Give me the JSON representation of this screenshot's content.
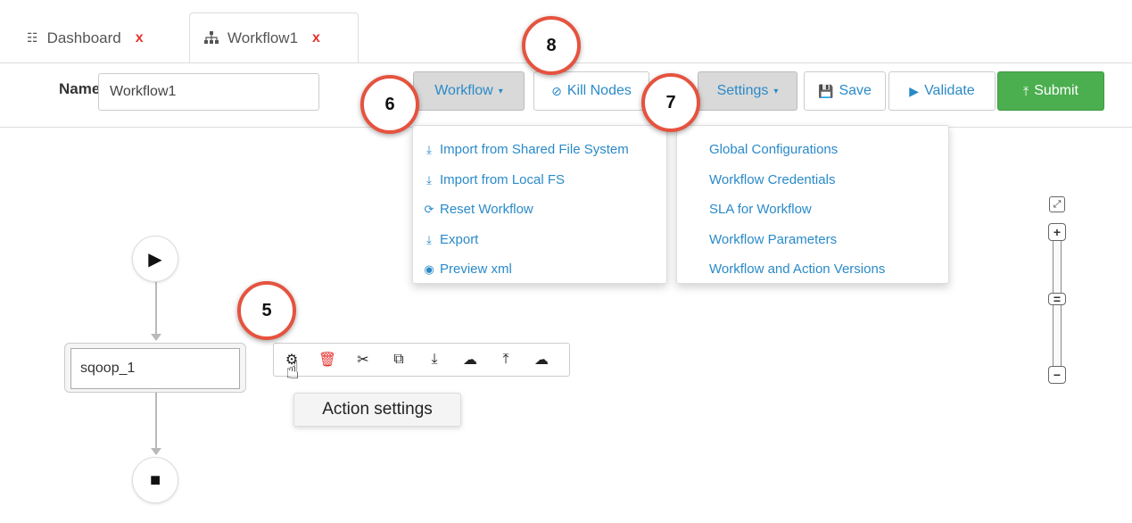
{
  "tabs": [
    {
      "label": "Dashboard",
      "icon": "grid-icon",
      "close": "x"
    },
    {
      "label": "Workflow1",
      "icon": "sitemap-icon",
      "close": "x"
    }
  ],
  "toolbar": {
    "name_label": "Name",
    "name_value": "Workflow1",
    "workflow_label": "Workflow",
    "kill_nodes_label": "Kill Nodes",
    "settings_label": "Settings",
    "save_label": "Save",
    "validate_label": "Validate",
    "submit_label": "Submit"
  },
  "workflow_menu": {
    "items": [
      {
        "label": "Import from Shared File System",
        "icon": "download-icon"
      },
      {
        "label": "Import from Local FS",
        "icon": "download-icon"
      },
      {
        "label": "Reset Workflow",
        "icon": "refresh-icon"
      },
      {
        "label": "Export",
        "icon": "download-icon"
      },
      {
        "label": "Preview xml",
        "icon": "eye-icon"
      }
    ]
  },
  "settings_menu": {
    "items": [
      {
        "label": "Global Configurations"
      },
      {
        "label": "Workflow Credentials"
      },
      {
        "label": "SLA for Workflow"
      },
      {
        "label": "Workflow Parameters"
      },
      {
        "label": "Workflow and Action Versions"
      }
    ]
  },
  "graph": {
    "node_label": "sqoop_1",
    "tooltip": "Action settings"
  },
  "callouts": {
    "c5": "5",
    "c6": "6",
    "c7": "7",
    "c8": "8"
  },
  "colors": {
    "link": "#2a8ac8",
    "submit": "#4bae4f",
    "close": "#e8322f",
    "callout_border": "#e5533f"
  }
}
